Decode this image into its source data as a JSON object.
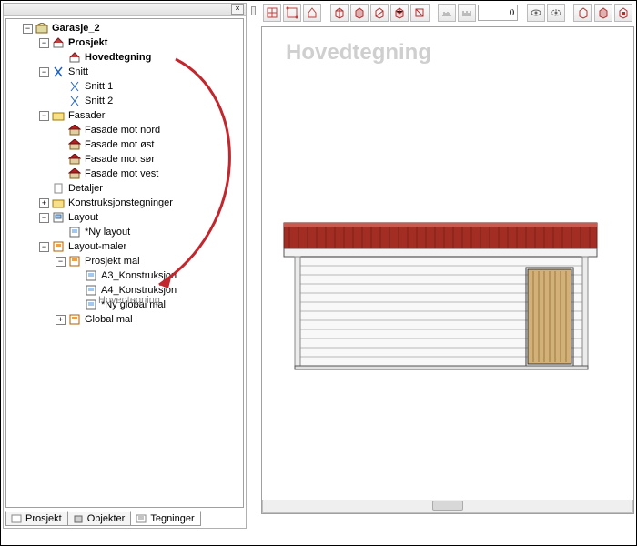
{
  "toolbar": {
    "numeric_value": "0"
  },
  "canvas": {
    "title": "Hovedtegning"
  },
  "drag_ghost": "Hovedtegning",
  "tree": {
    "root": "Garasje_2",
    "prosjekt": {
      "label": "Prosjekt",
      "hoved": "Hovedtegning"
    },
    "snitt": {
      "label": "Snitt",
      "items": [
        "Snitt 1",
        "Snitt 2"
      ]
    },
    "fasader": {
      "label": "Fasader",
      "items": [
        "Fasade mot nord",
        "Fasade mot øst",
        "Fasade mot sør",
        "Fasade mot vest"
      ]
    },
    "detaljer": "Detaljer",
    "konstruk": "Konstruksjonstegninger",
    "layout": {
      "label": "Layout",
      "items": [
        "*Ny layout"
      ]
    },
    "layoutmaler": {
      "label": "Layout-maler",
      "prosjekt_mal": {
        "label": "Prosjekt mal",
        "items": [
          "A3_Konstruksjon",
          "A4_Konstruksjon",
          "*Ny global mal"
        ]
      },
      "global_mal": "Global mal"
    }
  },
  "tabs": {
    "prosjekt": "Prosjekt",
    "objekter": "Objekter",
    "tegninger": "Tegninger"
  }
}
